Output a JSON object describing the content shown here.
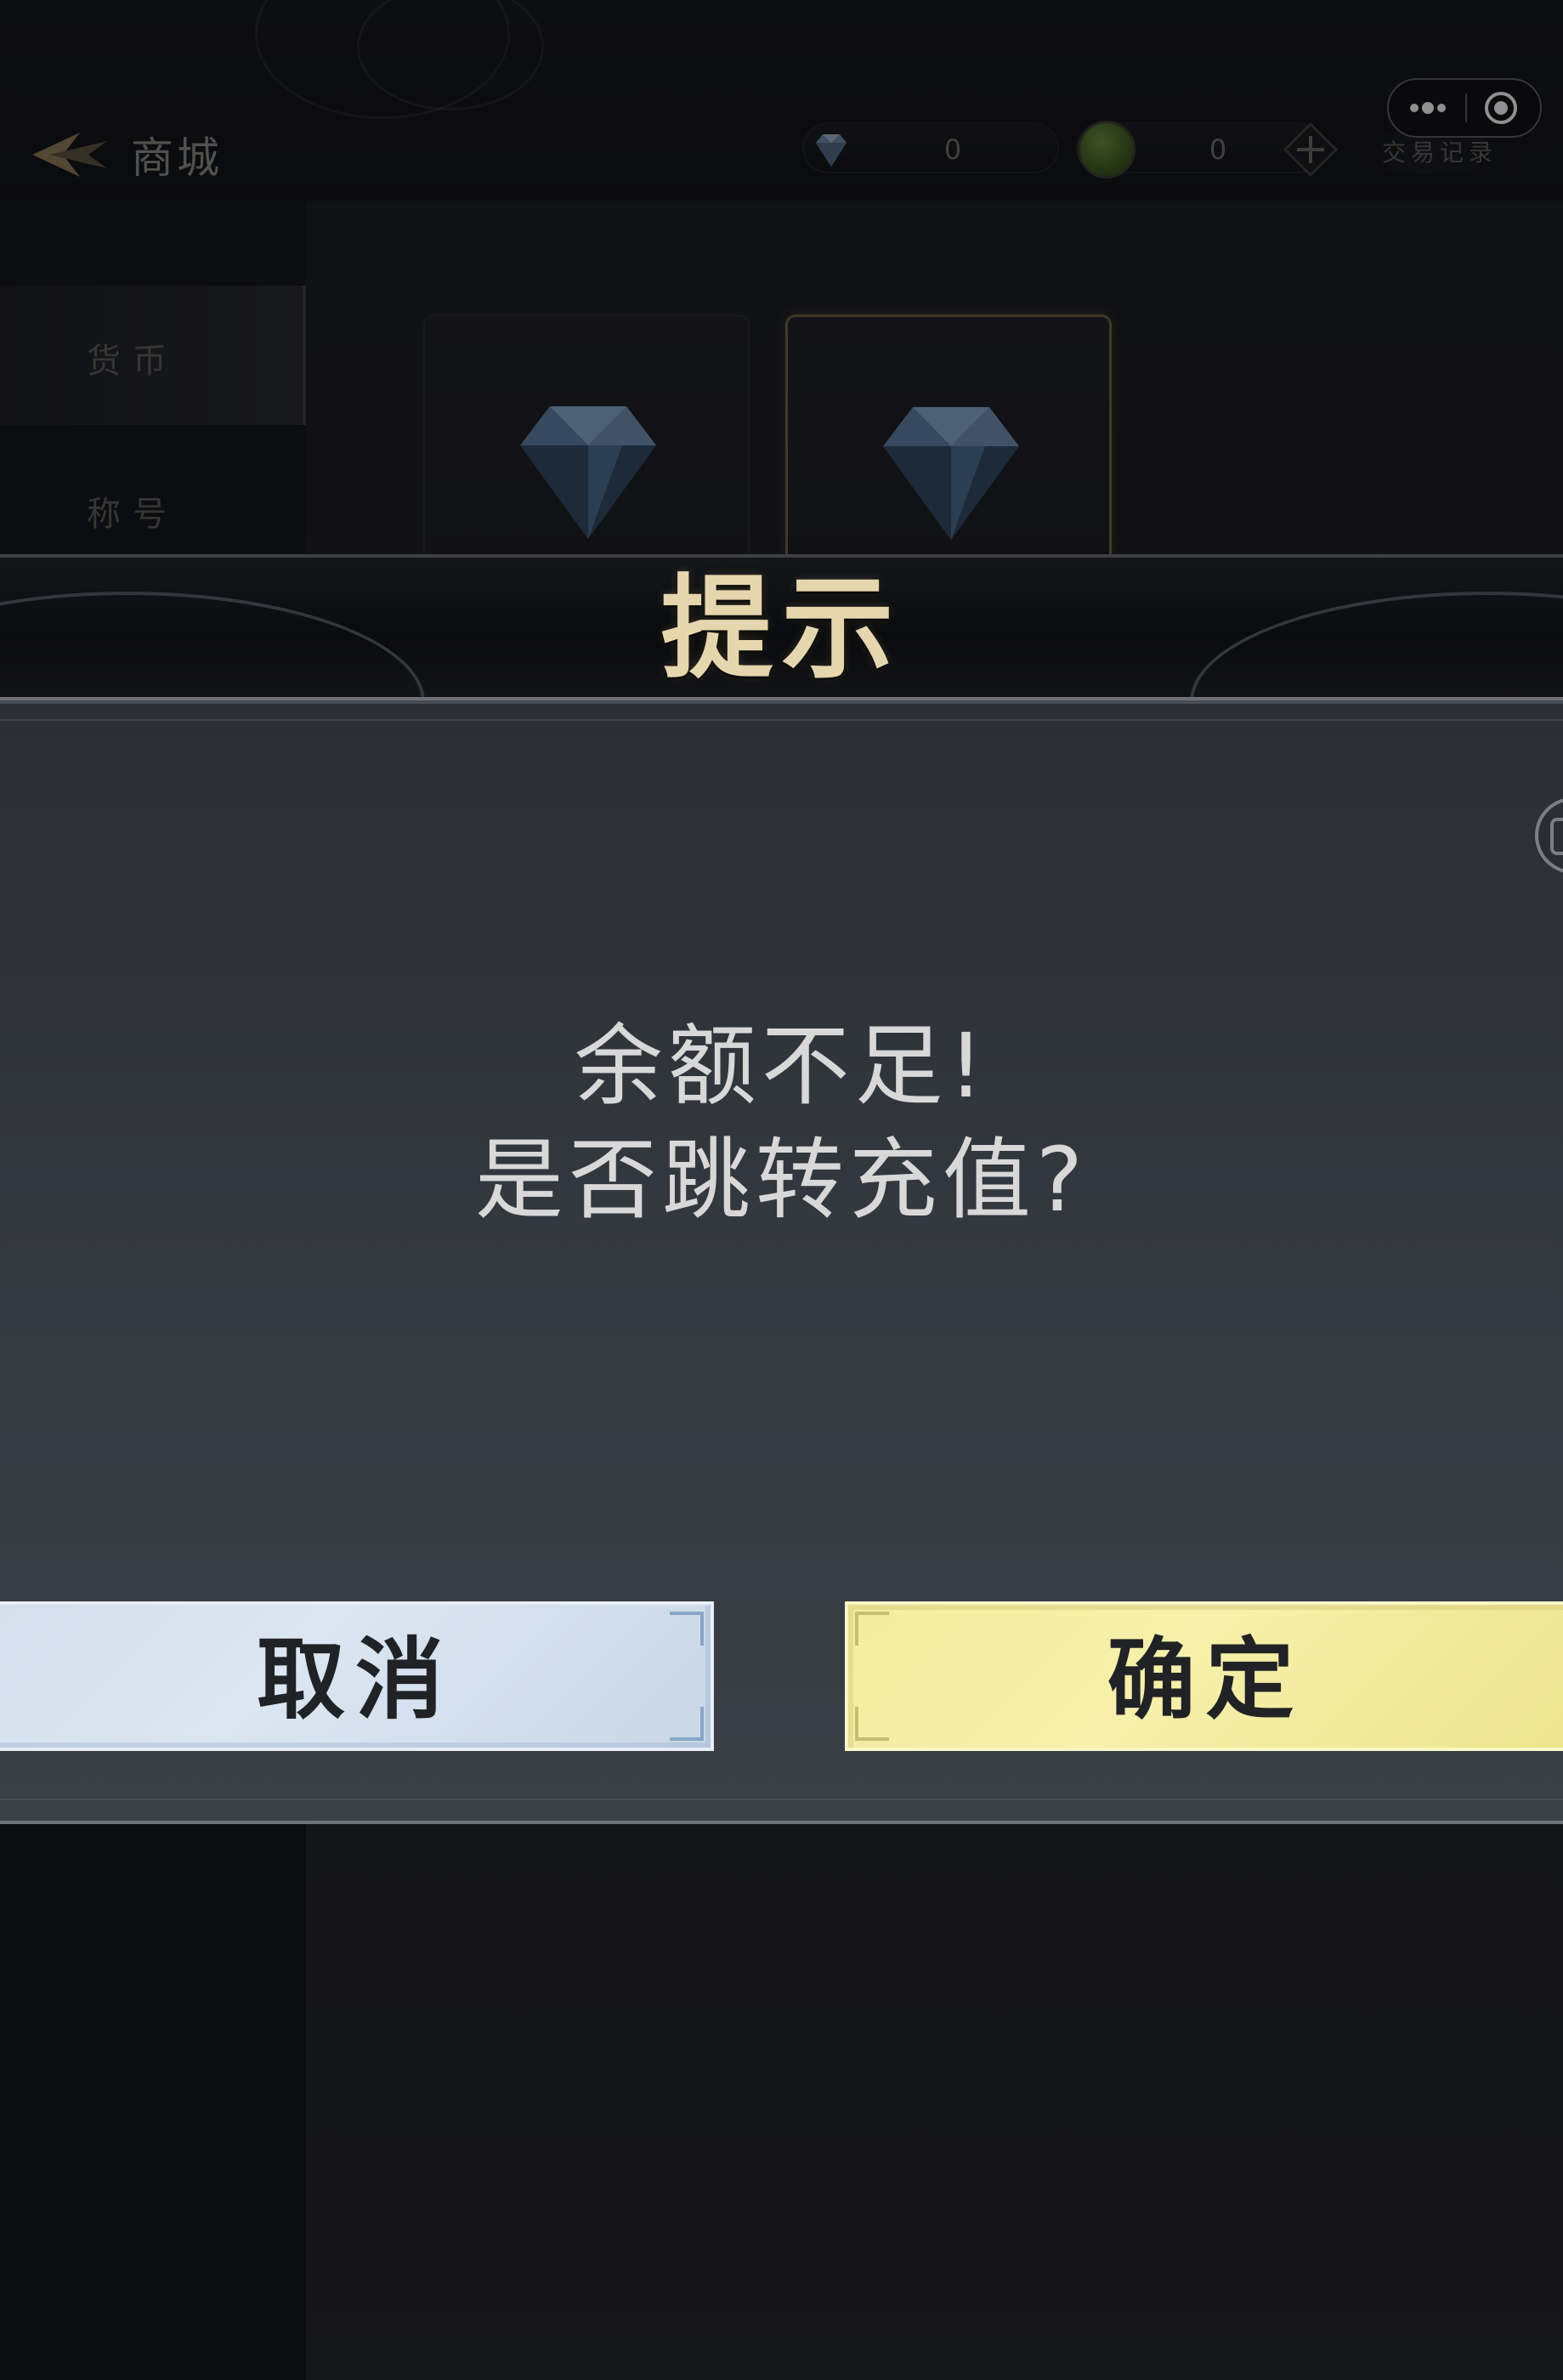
{
  "header": {
    "title": "商城",
    "diamond_balance": "0",
    "jade_balance": "0",
    "trade_record_label": "交易记录"
  },
  "sidebar": {
    "items": [
      {
        "label": "货币",
        "selected": true
      },
      {
        "label": "称号",
        "selected": false
      }
    ]
  },
  "dialog": {
    "title": "提示",
    "message_line1": "余额不足!",
    "message_line2": "是否跳转充值?",
    "cancel_label": "取消",
    "confirm_label": "确定"
  },
  "colors": {
    "dialog_title": "#e6d6ad",
    "cancel_button": "#d3dfec",
    "confirm_button": "#f3eda0"
  }
}
